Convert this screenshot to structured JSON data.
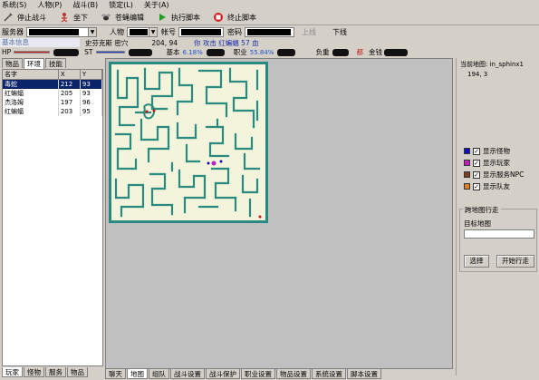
{
  "menu": {
    "items": [
      "系统(S)",
      "人物(P)",
      "战斗(B)",
      "锁定(L)",
      "关于(A)"
    ]
  },
  "toolbar": {
    "stop_battle": "停止战斗",
    "sit_down": "坐下",
    "script_edit": "苍蝇编辑",
    "run_script": "执行脚本",
    "stop_script": "终止脚本"
  },
  "conn": {
    "server_label": "服务器",
    "char_label": "人物",
    "account_label": "帐号",
    "password_label": "密码",
    "online_label": "上线",
    "offline_label": "下线"
  },
  "info": {
    "basic_info": "基本信息",
    "map_name": "史芬克斯 密穴",
    "coords": "204, 94",
    "attack_text": "你 攻击 红蝙蝠 57 血"
  },
  "stats": {
    "hp_label": "HP",
    "st_label": "ST",
    "basic_label": "基本",
    "basic_pct": "6.18%",
    "job_label": "职业",
    "job_pct": "55.84%",
    "load_label": "负重",
    "money_label": "金钱",
    "money_sep": "都"
  },
  "left_tabs": [
    "物品",
    "环境",
    "技能"
  ],
  "table": {
    "headers": [
      "名字",
      "X",
      "Y"
    ],
    "rows": [
      {
        "name": "毒蛇",
        "x": "212",
        "y": "93"
      },
      {
        "name": "红蝙蝠",
        "x": "205",
        "y": "93"
      },
      {
        "name": "杰洛姆",
        "x": "197",
        "y": "96"
      },
      {
        "name": "红蝙蝠",
        "x": "203",
        "y": "95"
      }
    ]
  },
  "left_bottom_tabs": [
    "玩家",
    "怪物",
    "服务",
    "物品"
  ],
  "map_tabs": [
    "聊天",
    "地图",
    "组队",
    "战斗设置",
    "战斗保护",
    "职业设置",
    "物品设置",
    "系统设置",
    "脚本设置"
  ],
  "right": {
    "cur_map_label": "当前地图:",
    "cur_map_value": "in_sphinx1",
    "cur_pos": "194, 3",
    "checks": [
      {
        "label": "显示怪物",
        "color": "#1010c0"
      },
      {
        "label": "显示玩家",
        "color": "#c020c0"
      },
      {
        "label": "显示服务NPC",
        "color": "#804020"
      },
      {
        "label": "显示队友",
        "color": "#e08020"
      }
    ],
    "walk_title": "跨地图行走",
    "target_label": "目标地图",
    "select_btn": "选择",
    "start_btn": "开始行走"
  },
  "colors": {
    "map_wall": "#2a8a80",
    "map_floor": "#f4f4dc",
    "hp_fill": "#d02020",
    "st_fill": "#2040d0"
  }
}
